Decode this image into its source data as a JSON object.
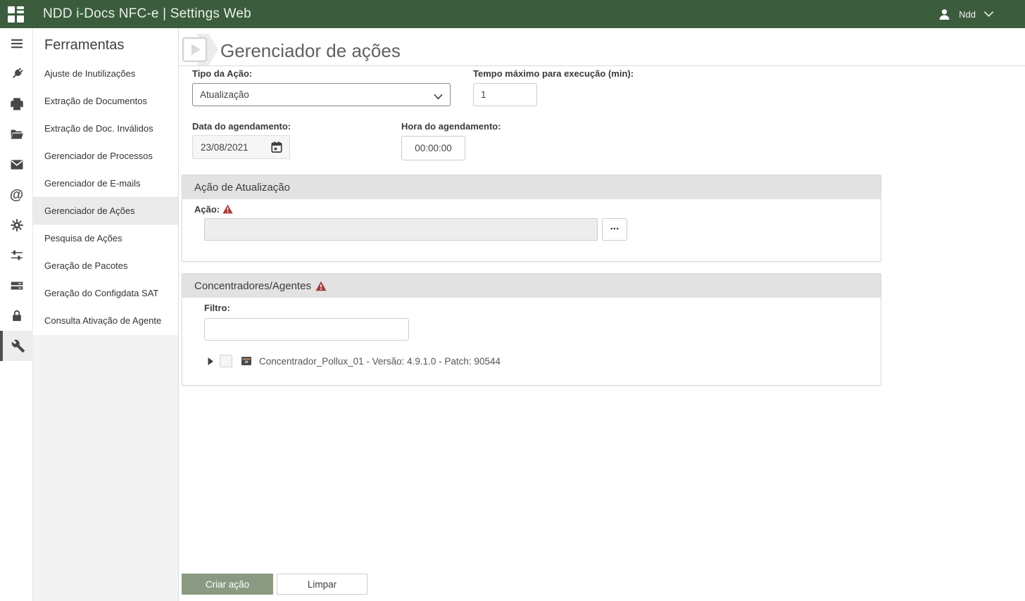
{
  "header": {
    "title": "NDD i-Docs NFC-e | Settings Web",
    "user_name": "Ndd"
  },
  "iconbar": {
    "items": [
      {
        "icon": "menu-icon"
      },
      {
        "icon": "plug-icon"
      },
      {
        "icon": "printer-icon"
      },
      {
        "icon": "folder-open-icon"
      },
      {
        "icon": "envelope-icon"
      },
      {
        "icon": "at-sign-icon"
      },
      {
        "icon": "gear-icon"
      },
      {
        "icon": "sliders-icon"
      },
      {
        "icon": "server-icon"
      },
      {
        "icon": "lock-icon"
      },
      {
        "icon": "wrench-icon",
        "active": true
      }
    ]
  },
  "sidebar": {
    "title": "Ferramentas",
    "items": [
      {
        "label": "Ajuste de Inutilizações",
        "selected": false
      },
      {
        "label": "Extração de Documentos",
        "selected": false
      },
      {
        "label": "Extração de Doc. Inválidos",
        "selected": false
      },
      {
        "label": "Gerenciador de Processos",
        "selected": false
      },
      {
        "label": "Gerenciador de E-mails",
        "selected": false
      },
      {
        "label": "Gerenciador de Ações",
        "selected": true
      },
      {
        "label": "Pesquisa de Ações",
        "selected": false
      },
      {
        "label": "Geração de Pacotes",
        "selected": false
      },
      {
        "label": "Geração do Configdata SAT",
        "selected": false
      },
      {
        "label": "Consulta Ativação de Agente",
        "selected": false
      }
    ]
  },
  "main": {
    "page_title": "Gerenciador de ações",
    "form": {
      "tipo_acao": {
        "label": "Tipo da Ação:",
        "value": "Atualização"
      },
      "tempo_maximo": {
        "label": "Tempo máximo para execução (min):",
        "value": "1"
      },
      "data_agendamento": {
        "label": "Data do agendamento:",
        "value": "23/08/2021"
      },
      "hora_agendamento": {
        "label": "Hora do agendamento:",
        "value": "00:00:00"
      }
    },
    "panel_acao": {
      "title": "Ação de Atualização",
      "acao_label": "Ação:",
      "acao_value": "",
      "browse_label": "..."
    },
    "panel_concentradores": {
      "title": "Concentradores/Agentes",
      "filtro_label": "Filtro:",
      "filtro_value": "",
      "tree_items": [
        {
          "label": "Concentrador_Pollux_01 - Versão: 4.9.1.0 - Patch: 90544",
          "checked": false,
          "expanded": false
        }
      ]
    },
    "actions": {
      "criar": "Criar ação",
      "limpar": "Limpar"
    }
  },
  "colors": {
    "header_green": "#3b5c3d",
    "button_green": "#8a9a82",
    "warning_red": "#a93c3c",
    "selected_gray": "#ebebeb"
  }
}
